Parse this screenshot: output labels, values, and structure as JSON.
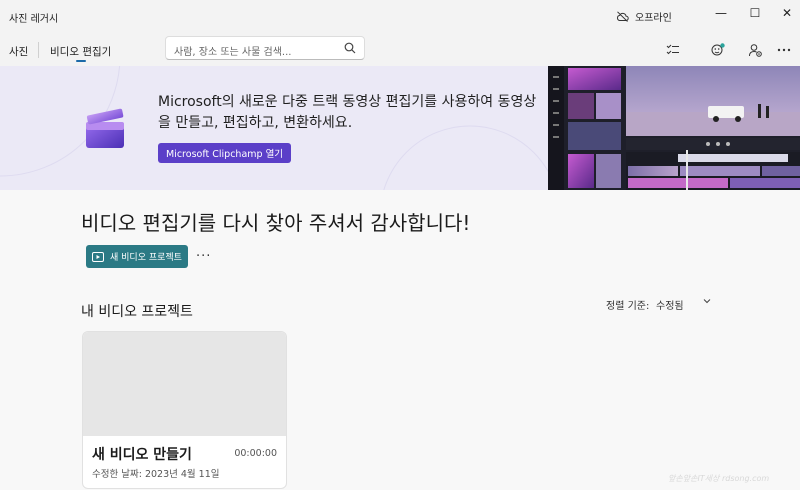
{
  "window": {
    "title": "사진 레거시",
    "status": "오프라인",
    "minimize_glyph": "—",
    "maximize_glyph": "☐",
    "close_glyph": "✕"
  },
  "nav": {
    "tabs": [
      {
        "label": "사진"
      },
      {
        "label": "비디오 편집기",
        "selected": true
      }
    ],
    "search": {
      "placeholder": "사람, 장소 또는 사물 검색..."
    },
    "icons": [
      "checklist-icon",
      "people-icon",
      "account-settings-icon",
      "more-icon"
    ]
  },
  "banner": {
    "text": "Microsoft의 새로운 다중 트랙 동영상 편집기를 사용하여 동영상을 만들고, 편집하고, 변환하세요.",
    "button_label": "Microsoft Clipchamp 열기"
  },
  "main": {
    "heading": "비디오 편집기를 다시 찾아 주셔서 감사합니다!",
    "new_project_label": "새 비디오 프로젝트",
    "more_label": "···",
    "section_title": "내 비디오 프로젝트",
    "sort_label": "정렬 기준:",
    "sort_value": "수정됨"
  },
  "projects": [
    {
      "title": "새 비디오 만들기",
      "duration": "00:00:00",
      "modified": "수정한 날짜: 2023년 4월 11일"
    }
  ],
  "watermark": "앞손앞손IT세상 rdsong.com",
  "colors": {
    "accent": "#5b3fc8",
    "primary_button": "#2b7a85",
    "banner_bg": "#ebe9f6",
    "selected_tab": "#1b6aa8"
  }
}
